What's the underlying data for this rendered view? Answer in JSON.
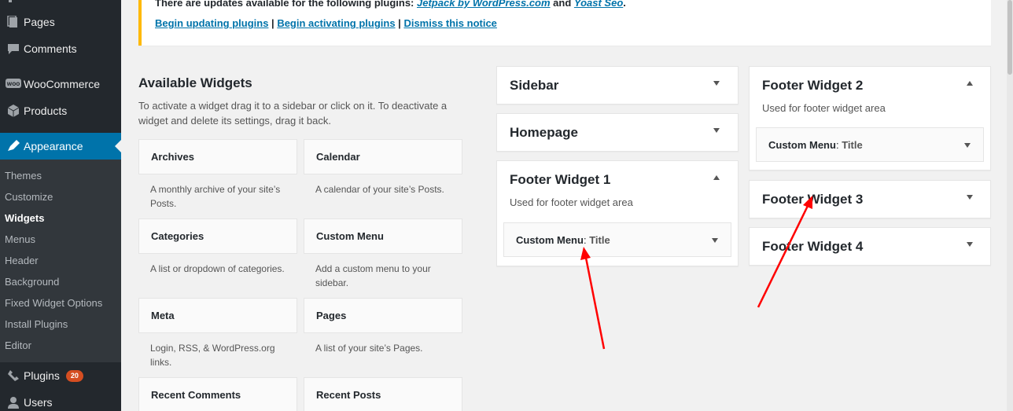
{
  "sidebar": {
    "menu": [
      {
        "label": "Pages",
        "icon": "pages-icon"
      },
      {
        "label": "Comments",
        "icon": "comments-icon"
      },
      {
        "label": "WooCommerce",
        "icon": "woocommerce-icon"
      },
      {
        "label": "Products",
        "icon": "products-icon"
      },
      {
        "label": "Appearance",
        "icon": "appearance-icon"
      },
      {
        "label": "Plugins",
        "icon": "plugins-icon",
        "badge": "20"
      },
      {
        "label": "Users",
        "icon": "users-icon"
      }
    ],
    "submenu": [
      "Themes",
      "Customize",
      "Widgets",
      "Menus",
      "Header",
      "Background",
      "Fixed Widget Options",
      "Install Plugins",
      "Editor"
    ],
    "colors": {
      "bg": "#23282d",
      "active": "#0073aa",
      "submenu_bg": "#32373c"
    }
  },
  "notice": {
    "text_prefix": "There are updates available for the following plugins: ",
    "plugin1": "Jetpack by WordPress.com",
    "and": " and ",
    "plugin2": "Yoast Seo",
    "period": ".",
    "link_update": "Begin updating plugins",
    "link_activate": "Begin activating plugins",
    "link_dismiss": "Dismiss this notice",
    "separator": " | "
  },
  "available": {
    "title": "Available Widgets",
    "description": "To activate a widget drag it to a sidebar or click on it. To deactivate a widget and delete its settings, drag it back.",
    "widgets": [
      {
        "title": "Archives",
        "desc": "A monthly archive of your site’s Posts."
      },
      {
        "title": "Calendar",
        "desc": "A calendar of your site’s Posts."
      },
      {
        "title": "Categories",
        "desc": "A list or dropdown of categories."
      },
      {
        "title": "Custom Menu",
        "desc": "Add a custom menu to your sidebar."
      },
      {
        "title": "Meta",
        "desc": "Login, RSS, & WordPress.org links."
      },
      {
        "title": "Pages",
        "desc": "A list of your site’s Pages."
      },
      {
        "title": "Recent Comments",
        "desc": ""
      },
      {
        "title": "Recent Posts",
        "desc": ""
      }
    ]
  },
  "areas": {
    "sidebar": {
      "title": "Sidebar"
    },
    "homepage": {
      "title": "Homepage"
    },
    "footer1": {
      "title": "Footer Widget 1",
      "desc": "Used for footer widget area",
      "widget_name": "Custom Menu",
      "widget_sep": ": ",
      "widget_title": "Title"
    },
    "footer2": {
      "title": "Footer Widget 2",
      "desc": "Used for footer widget area",
      "widget_name": "Custom Menu",
      "widget_sep": ": ",
      "widget_title": "Title"
    },
    "footer3": {
      "title": "Footer Widget 3"
    },
    "footer4": {
      "title": "Footer Widget 4"
    }
  },
  "annotation_color": "#ff0000"
}
